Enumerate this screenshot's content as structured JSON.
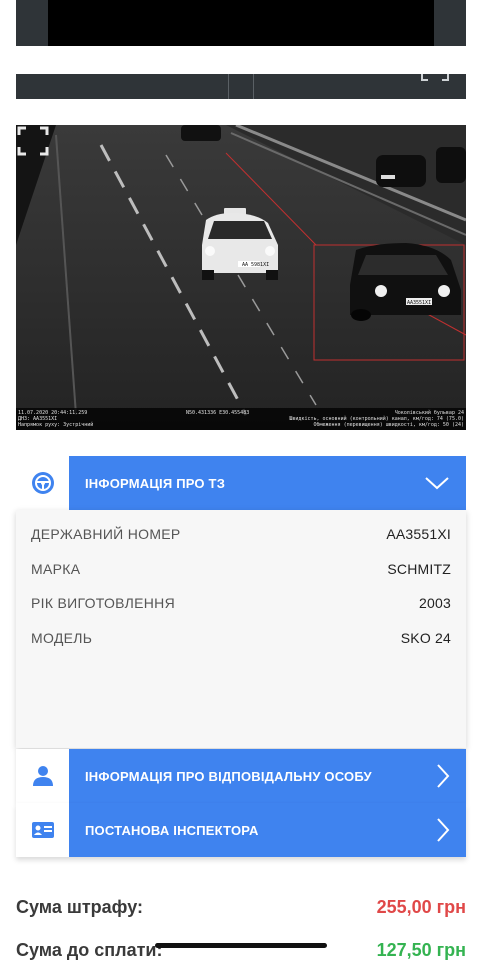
{
  "photo_overlay": {
    "left_line1": "11.07.2020 20:44:11.259",
    "left_line2": "ДНЗ: AA3551XI",
    "left_line3": "Напрямок руху: Зустрічний",
    "middle": "N50.431336 E30.455483",
    "right_line1": "Чоколівський бульвар 24",
    "right_line2": "Швидкість, основний (контрольний) канал, км/год: 74 (75.0)",
    "right_line3": "Обмеження (перевищення) швидкості, км/год: 50 (24)",
    "plate_taxi": "AA 5981XI",
    "plate_car": "AA3551XI"
  },
  "vehicle_section": {
    "title": "ІНФОРМАЦІЯ ПРО ТЗ",
    "icon": "steering-wheel-icon",
    "expanded": true,
    "rows": [
      {
        "label": "ДЕРЖАВНИЙ НОМЕР",
        "value": "AA3551XI"
      },
      {
        "label": "МАРКА",
        "value": "SCHMITZ"
      },
      {
        "label": "РІК ВИГОТОВЛЕННЯ",
        "value": "2003"
      },
      {
        "label": "МОДЕЛЬ",
        "value": "SKO 24"
      }
    ]
  },
  "person_section": {
    "title": "ІНФОРМАЦІЯ ПРО ВІДПОВІДАЛЬНУ ОСОБУ",
    "icon": "person-icon"
  },
  "inspector_section": {
    "title": "ПОСТАНОВА ІНСПЕКТОРА",
    "icon": "id-card-icon"
  },
  "totals": {
    "fine_label": "Сума штрафу:",
    "fine_value": "255,00 грн",
    "pay_label": "Сума до сплати:",
    "pay_value": "127,50 грн"
  },
  "colors": {
    "accent": "#3f83ef",
    "fine": "#e04848",
    "pay": "#34b351"
  }
}
